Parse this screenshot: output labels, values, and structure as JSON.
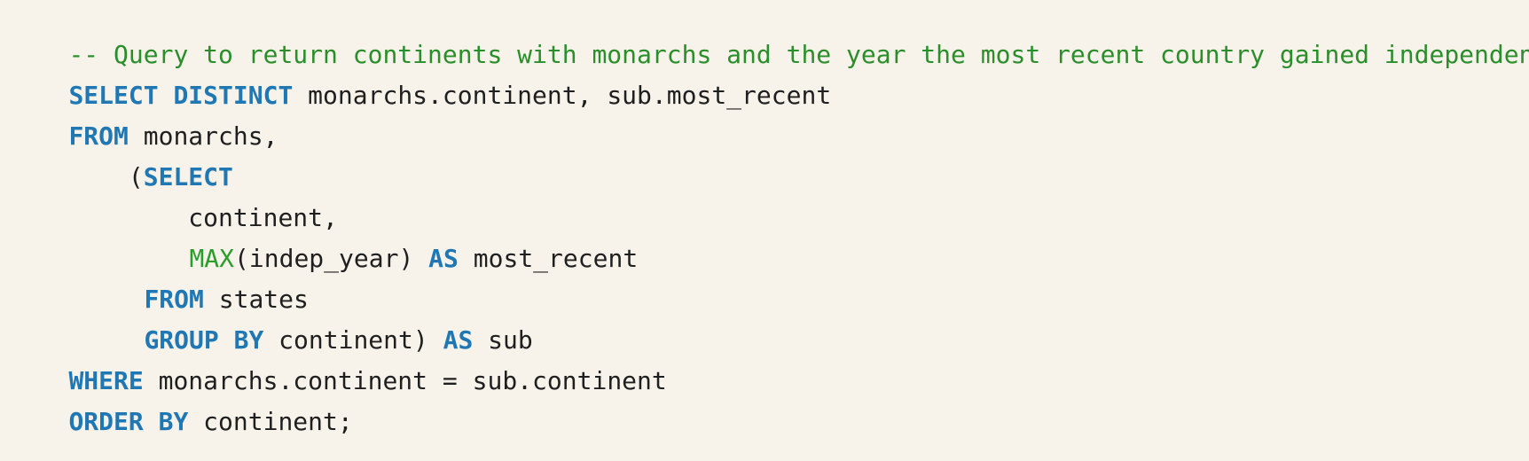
{
  "code": {
    "comment": "-- Query to return continents with monarchs and the year the most recent country gained independence",
    "line1": {
      "kw": "SELECT DISTINCT",
      "text": " monarchs.continent, sub.most_recent"
    },
    "line2": {
      "kw": "FROM",
      "text": " monarchs,"
    },
    "line3": {
      "indent": "    (",
      "kw": "SELECT"
    },
    "line4": {
      "text": "        continent,"
    },
    "line5": {
      "fn": "MAX",
      "text1": "(indep_year) ",
      "kw": "AS",
      "text2": " most_recent"
    },
    "line6": {
      "kw": "FROM",
      "text": " states"
    },
    "line7": {
      "kw1": "GROUP BY",
      "text1": " continent) ",
      "kw2": "AS",
      "text2": " sub"
    },
    "line8": {
      "kw": "WHERE",
      "text": " monarchs.continent = sub.continent"
    },
    "line9": {
      "kw": "ORDER BY",
      "text": " continent;"
    }
  }
}
